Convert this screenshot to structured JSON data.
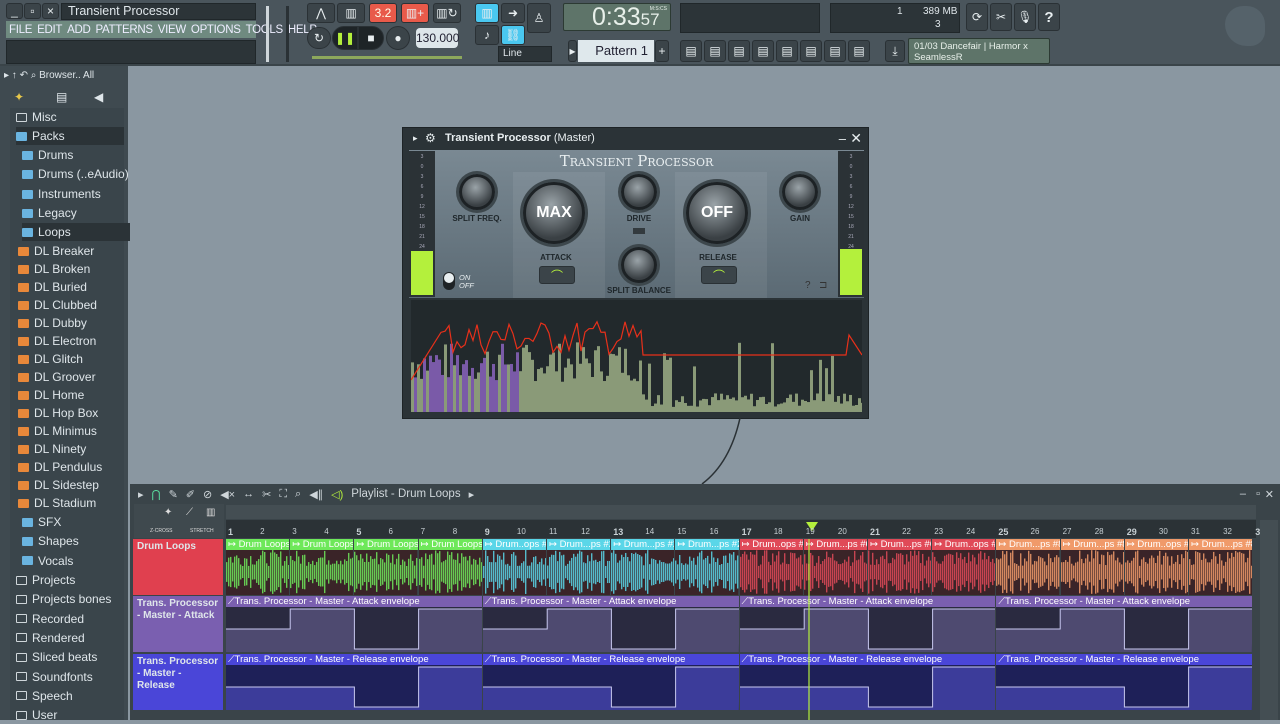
{
  "window": {
    "title": "Transient Processor",
    "minimize": "_",
    "restore": "▫",
    "close": "×"
  },
  "menu": [
    "FILE",
    "EDIT",
    "ADD",
    "PATTERNS",
    "VIEW",
    "OPTIONS",
    "TOOLS",
    "HELP"
  ],
  "transport": {
    "tempo": "130.000",
    "time": "0:33",
    "time_sub": "57",
    "time_unit": "M:S:CS",
    "snap": "Line",
    "pattern": "Pattern 1",
    "pattern_add": "+",
    "song_mode": "3.2"
  },
  "status": {
    "cpu": "1",
    "memory": "389 MB",
    "polyphony": "3"
  },
  "news": {
    "text1": "01/03  Dancefair | Harmor x",
    "text2": "SeamlessR"
  },
  "browser": {
    "header": "Browser.. All",
    "items": [
      {
        "label": "Misc",
        "type": "folder",
        "level": 0
      },
      {
        "label": "Packs",
        "type": "pack",
        "level": 0
      },
      {
        "label": "Drums",
        "type": "pack",
        "level": 1
      },
      {
        "label": "Drums (..eAudio)",
        "type": "pack",
        "level": 1
      },
      {
        "label": "Instruments",
        "type": "pack",
        "level": 1
      },
      {
        "label": "Legacy",
        "type": "pack",
        "level": 1
      },
      {
        "label": "Loops",
        "type": "pack",
        "level": 1
      },
      {
        "label": "DL Breaker",
        "type": "loop",
        "level": 2
      },
      {
        "label": "DL Broken",
        "type": "loop",
        "level": 2
      },
      {
        "label": "DL Buried",
        "type": "loop",
        "level": 2
      },
      {
        "label": "DL Clubbed",
        "type": "loop",
        "level": 2
      },
      {
        "label": "DL Dubby",
        "type": "loop",
        "level": 2
      },
      {
        "label": "DL Electron",
        "type": "loop",
        "level": 2
      },
      {
        "label": "DL Glitch",
        "type": "loop",
        "level": 2
      },
      {
        "label": "DL Groover",
        "type": "loop",
        "level": 2
      },
      {
        "label": "DL Home",
        "type": "loop",
        "level": 2
      },
      {
        "label": "DL Hop Box",
        "type": "loop",
        "level": 2
      },
      {
        "label": "DL Minimus",
        "type": "loop",
        "level": 2
      },
      {
        "label": "DL Ninety",
        "type": "loop",
        "level": 2
      },
      {
        "label": "DL Pendulus",
        "type": "loop",
        "level": 2
      },
      {
        "label": "DL Sidestep",
        "type": "loop",
        "level": 2
      },
      {
        "label": "DL Stadium",
        "type": "loop",
        "level": 2
      },
      {
        "label": "SFX",
        "type": "pack",
        "level": 1
      },
      {
        "label": "Shapes",
        "type": "pack",
        "level": 1
      },
      {
        "label": "Vocals",
        "type": "pack",
        "level": 1
      },
      {
        "label": "Projects",
        "type": "folder",
        "level": 0
      },
      {
        "label": "Projects bones",
        "type": "folder",
        "level": 0
      },
      {
        "label": "Recorded",
        "type": "folder",
        "level": 0
      },
      {
        "label": "Rendered",
        "type": "folder",
        "level": 0
      },
      {
        "label": "Sliced beats",
        "type": "folder",
        "level": 0
      },
      {
        "label": "Soundfonts",
        "type": "folder",
        "level": 0
      },
      {
        "label": "Speech",
        "type": "folder",
        "level": 0
      },
      {
        "label": "User",
        "type": "folder",
        "level": 0
      }
    ]
  },
  "plugin": {
    "title": "Transient Processor",
    "title_suffix": "(Master)",
    "brand": "Transient Processor",
    "knobs": {
      "split_freq": "SPLIT FREQ.",
      "attack": "ATTACK",
      "attack_value": "MAX",
      "drive": "DRIVE",
      "split_balance": "SPLIT BALANCE",
      "release": "RELEASE",
      "release_value": "OFF",
      "gain": "GAIN"
    },
    "on": "ON",
    "off": "OFF",
    "help": "?",
    "meter_scale": [
      "3",
      "0",
      "3",
      "6",
      "9",
      "12",
      "15",
      "18",
      "21",
      "24"
    ]
  },
  "playlist": {
    "title": "Playlist - Drum Loops",
    "zcross": "Z-CROSS",
    "stretch": "STRETCH",
    "bars": [
      "1",
      "2",
      "3",
      "4",
      "5",
      "6",
      "7",
      "8",
      "9",
      "10",
      "11",
      "12",
      "13",
      "14",
      "15",
      "16",
      "17",
      "18",
      "19",
      "20",
      "21",
      "22",
      "23",
      "24",
      "25",
      "26",
      "27",
      "28",
      "29",
      "30",
      "31",
      "32",
      "3"
    ],
    "tracks": [
      {
        "name": "Drum Loops",
        "color": "#e0404f",
        "clips": [
          {
            "label": "Drum Loops",
            "color": "#6ee85a"
          },
          {
            "label": "Drum Loops",
            "color": "#6ee85a"
          },
          {
            "label": "Drum Loops",
            "color": "#6ee85a"
          },
          {
            "label": "Drum Loops",
            "color": "#6ee85a"
          },
          {
            "label": "Drum..ops #2",
            "color": "#5ad6e8"
          },
          {
            "label": "Drum...ps #2",
            "color": "#5ad6e8"
          },
          {
            "label": "Drum...ps #2",
            "color": "#5ad6e8"
          },
          {
            "label": "Drum...ps #2",
            "color": "#5ad6e8"
          },
          {
            "label": "Drum..ops #6",
            "color": "#e04a58"
          },
          {
            "label": "Drum...ps #6",
            "color": "#e04a58"
          },
          {
            "label": "Drum...ps #6",
            "color": "#e04a58"
          },
          {
            "label": "Drum..ops #6",
            "color": "#e04a58"
          },
          {
            "label": "Drum...ps #8",
            "color": "#f09a6a"
          },
          {
            "label": "Drum...ps #8",
            "color": "#f09a6a"
          },
          {
            "label": "Drum..ops #8",
            "color": "#f09a6a"
          },
          {
            "label": "Drum...ps #8",
            "color": "#f09a6a"
          }
        ]
      },
      {
        "name": "Trans. Processor - Master - Attack",
        "color": "#7a5fb0",
        "clip": "Trans. Processor - Master - Attack envelope",
        "levels": [
          0.5,
          0.5,
          1,
          1,
          0,
          0,
          1,
          1
        ]
      },
      {
        "name": "Trans. Processor - Master - Release",
        "color": "#4a46d8",
        "clip": "Trans. Processor - Master - Release envelope",
        "levels": [
          0.5,
          0.5,
          0.5,
          0.5,
          0,
          0,
          1,
          1
        ]
      }
    ]
  },
  "colors": {
    "accent_green": "#b4f03c",
    "record_red": "#e85a4a",
    "link_blue": "#4ac8f0"
  }
}
